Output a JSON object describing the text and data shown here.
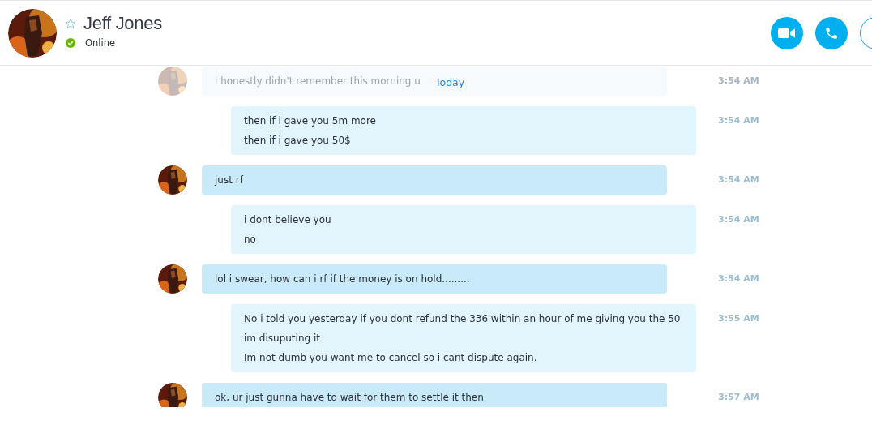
{
  "contact": {
    "name": "Jeff Jones",
    "favorite": false,
    "status": "Online"
  },
  "call_buttons": [
    {
      "kind": "video"
    },
    {
      "kind": "audio"
    },
    {
      "kind": "more"
    }
  ],
  "date_divider": "Today",
  "messages": [
    {
      "kind": "incoming",
      "faded": true,
      "lines": [
        "i honestly didn't remember this morning u"
      ],
      "time": "3:54 AM"
    },
    {
      "kind": "outgoing",
      "faded": false,
      "lines": [
        "then if i gave you 5m more",
        "then if i gave you 50$"
      ],
      "time": "3:54 AM"
    },
    {
      "kind": "incoming",
      "faded": false,
      "lines": [
        "just rf"
      ],
      "time": "3:54 AM"
    },
    {
      "kind": "outgoing",
      "faded": false,
      "lines": [
        "i dont believe you",
        "no"
      ],
      "time": "3:54 AM"
    },
    {
      "kind": "incoming",
      "faded": false,
      "lines": [
        "lol i swear, how can i rf if the money is on hold........."
      ],
      "time": "3:54 AM"
    },
    {
      "kind": "outgoing",
      "faded": false,
      "lines": [
        "No i told you yesterday if you dont refund the 336 within an hour of me giving you the 50",
        "im disuputing it",
        "Im not dumb you want me to cancel so i cant dispute again."
      ],
      "time": "3:55 AM"
    },
    {
      "kind": "incoming",
      "faded": false,
      "lines": [
        "ok, ur just gunna have to wait for them to settle it then"
      ],
      "time": "3:57 AM"
    }
  ]
}
